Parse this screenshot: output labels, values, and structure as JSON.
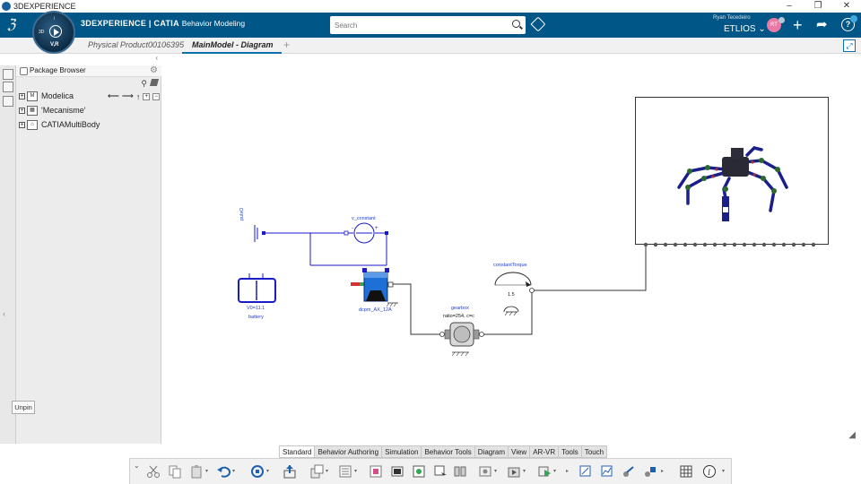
{
  "window": {
    "title": "3DEXPERIENCE",
    "controls": {
      "minimize": "–",
      "maximize": "❐",
      "close": "✕"
    }
  },
  "header": {
    "brand_main": "3DEXPERIENCE | CATIA",
    "brand_app": "Behavior Modeling",
    "compass": {
      "label_3d": "3D",
      "label_v": "V,R",
      "label_i": "i"
    },
    "search_placeholder": "Search",
    "user_name": "Ryan Tecedeiro",
    "tenant": "ETLIOS ⌄",
    "avatar_initials": "RT",
    "help_glyph": "?"
  },
  "tabs": [
    {
      "label": "Physical Product00106395",
      "active": false
    },
    {
      "label": "MainModel - Diagram",
      "active": true
    }
  ],
  "tab_add": "+",
  "left_panel": {
    "title": "Package Browser",
    "tree": [
      {
        "label": "Modelica",
        "toggle": "+"
      },
      {
        "label": "'Mecanisme'",
        "toggle": "+"
      },
      {
        "label": "CATIAMultiBody",
        "toggle": "+"
      }
    ],
    "tree_controls": [
      "⟵",
      "⟶",
      "↑"
    ],
    "unpin_label": "Unpin"
  },
  "diagram": {
    "labels": {
      "v_constant": "v_constant",
      "pulse": "pulsO",
      "battery_value": "V0=11.1",
      "battery": "battery",
      "motor": "dcpm_AX_12A",
      "gearbox": "gearbox",
      "gearbox_param": "ratio=254, c=c",
      "torque": "constantTorque",
      "torque_value": "1.5"
    },
    "colors": {
      "wire": "#1a1ac8",
      "mech_wire": "#333333",
      "motor_blue": "#1e6fd6",
      "robot_leg": "#1a1f8a",
      "robot_joint": "#2c6a2c"
    }
  },
  "bottom_tabs": [
    "Standard",
    "Behavior Authoring",
    "Simulation",
    "Behavior Tools",
    "Diagram",
    "View",
    "AR-VR",
    "Tools",
    "Touch"
  ],
  "active_bottom_tab": "Standard",
  "toolbar_icons": [
    "cut-icon",
    "copy-icon",
    "paste-icon",
    "undo-icon",
    "update-icon",
    "share-icon",
    "insert-icon",
    "property-icon",
    "model-icon",
    "view-icon",
    "connect-icon",
    "library-icon",
    "component-icon",
    "sensor-icon",
    "simulate-icon",
    "play-icon",
    "result-icon",
    "plot-icon",
    "export-icon",
    "mechanism-icon",
    "grid-icon",
    "info-icon"
  ],
  "resize_glyph": "◢"
}
